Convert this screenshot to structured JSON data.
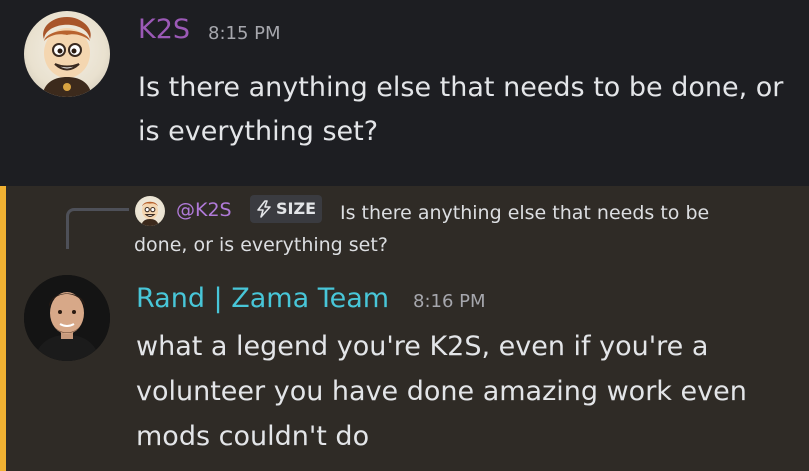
{
  "messages": [
    {
      "author": "K2S",
      "time": "8:15 PM",
      "author_color": "#9b59b6",
      "text": "Is there anything else that needs to be done, or is everything set?"
    },
    {
      "author": "Rand | Zama Team",
      "time": "8:16 PM",
      "author_color": "#48c6d8",
      "reply": {
        "mention": "@K2S",
        "tag_icon": "lightning-icon",
        "tag": "SIZE",
        "text": "Is there anything else that needs to be done, or is everything set?"
      },
      "text": "what a legend you're K2S, even if you're a volunteer you have done amazing work even mods couldn't do",
      "highlight_color": "#f0b132"
    }
  ]
}
